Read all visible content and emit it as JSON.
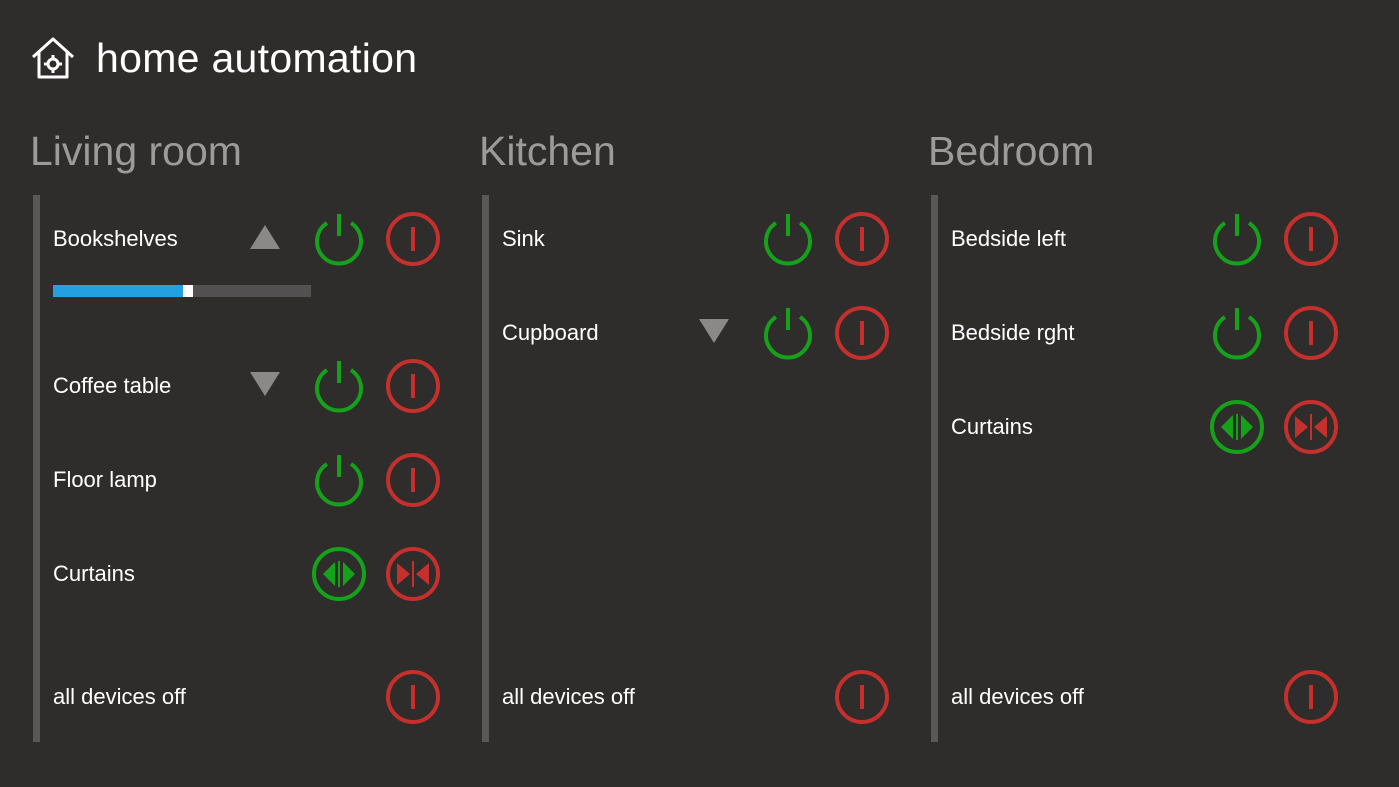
{
  "app": {
    "title": "home automation"
  },
  "colors": {
    "background": "#2f2d2c",
    "on": "#15a11a",
    "off": "#c5302d",
    "accent": "#23a0e0",
    "room_title": "#9d9b99",
    "arrow": "#8b8987"
  },
  "rooms": [
    {
      "name": "Living room",
      "devices": [
        {
          "label": "Bookshelves",
          "arrow": "up",
          "on_icon": "power-icon",
          "off_icon": "off-icon",
          "dim_level": 0.52
        },
        {
          "label": "Coffee table",
          "arrow": "down",
          "on_icon": "power-icon",
          "off_icon": "off-icon"
        },
        {
          "label": "Floor lamp",
          "on_icon": "power-icon",
          "off_icon": "off-icon"
        },
        {
          "label": "Curtains",
          "on_icon": "curtain-open-icon",
          "off_icon": "curtain-close-icon"
        }
      ],
      "all_off_label": "all devices off"
    },
    {
      "name": "Kitchen",
      "devices": [
        {
          "label": "Sink",
          "on_icon": "power-icon",
          "off_icon": "off-icon"
        },
        {
          "label": "Cupboard",
          "arrow": "down",
          "on_icon": "power-icon",
          "off_icon": "off-icon"
        }
      ],
      "all_off_label": "all devices off"
    },
    {
      "name": "Bedroom",
      "devices": [
        {
          "label": "Bedside left",
          "on_icon": "power-icon",
          "off_icon": "off-icon"
        },
        {
          "label": "Bedside rght",
          "on_icon": "power-icon",
          "off_icon": "off-icon"
        },
        {
          "label": "Curtains",
          "on_icon": "curtain-open-icon",
          "off_icon": "curtain-close-icon"
        }
      ],
      "all_off_label": "all devices off"
    }
  ]
}
